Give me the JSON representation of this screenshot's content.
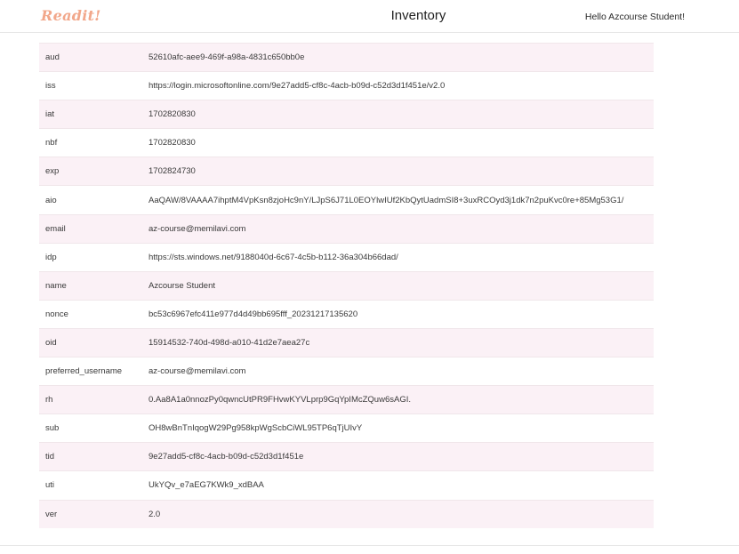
{
  "header": {
    "brand": "Readit!",
    "title": "Inventory",
    "greeting": "Hello Azcourse Student!"
  },
  "claims": [
    {
      "key": "aud",
      "value": "52610afc-aee9-469f-a98a-4831c650bb0e"
    },
    {
      "key": "iss",
      "value": "https://login.microsoftonline.com/9e27add5-cf8c-4acb-b09d-c52d3d1f451e/v2.0"
    },
    {
      "key": "iat",
      "value": "1702820830"
    },
    {
      "key": "nbf",
      "value": "1702820830"
    },
    {
      "key": "exp",
      "value": "1702824730"
    },
    {
      "key": "aio",
      "value": "AaQAW/8VAAAA7ihptM4VpKsn8zjoHc9nY/LJpS6J71L0EOYlwIUf2KbQytUadmSI8+3uxRCOyd3j1dk7n2puKvc0re+85Mg53G1/"
    },
    {
      "key": "email",
      "value": "az-course@memilavi.com"
    },
    {
      "key": "idp",
      "value": "https://sts.windows.net/9188040d-6c67-4c5b-b112-36a304b66dad/"
    },
    {
      "key": "name",
      "value": "Azcourse Student"
    },
    {
      "key": "nonce",
      "value": "bc53c6967efc411e977d4d49bb695fff_20231217135620"
    },
    {
      "key": "oid",
      "value": "15914532-740d-498d-a010-41d2e7aea27c"
    },
    {
      "key": "preferred_username",
      "value": "az-course@memilavi.com"
    },
    {
      "key": "rh",
      "value": "0.Aa8A1a0nnozPy0qwncUtPR9FHvwKYVLprp9GqYpIMcZQuw6sAGI."
    },
    {
      "key": "sub",
      "value": "OH8wBnTnIqogW29Pg958kpWgScbCiWL95TP6qTjUIvY"
    },
    {
      "key": "tid",
      "value": "9e27add5-cf8c-4acb-b09d-c52d3d1f451e"
    },
    {
      "key": "uti",
      "value": "UkYQv_e7aEG7KWk9_xdBAA"
    },
    {
      "key": "ver",
      "value": "2.0"
    }
  ]
}
